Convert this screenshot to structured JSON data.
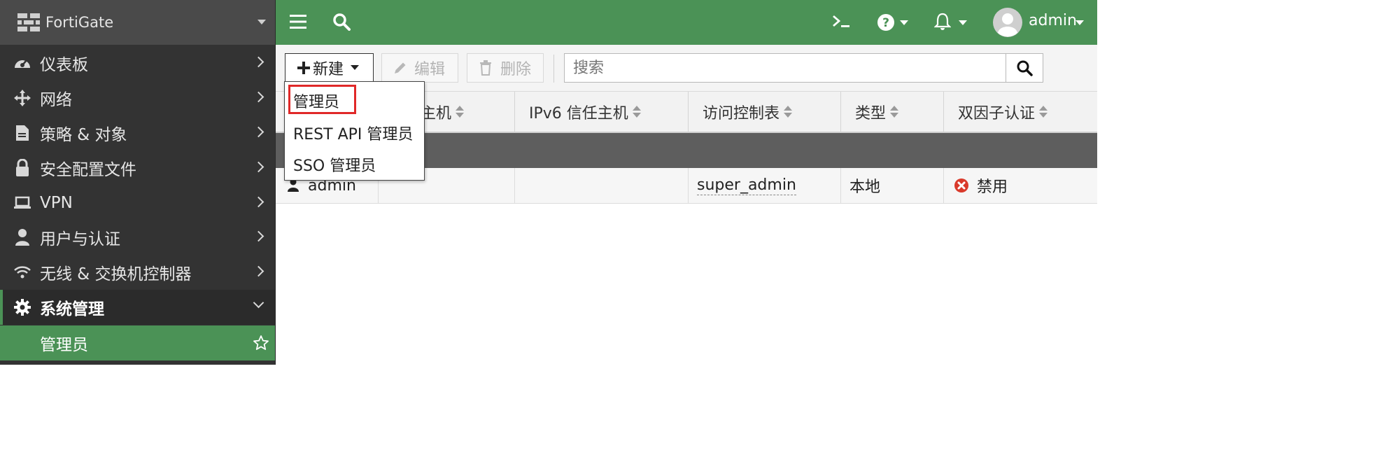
{
  "brand": {
    "name": "FortiGate"
  },
  "sidebar": {
    "items": [
      {
        "label": "仪表板",
        "icon": "dashboard-icon"
      },
      {
        "label": "网络",
        "icon": "move-arrows-icon"
      },
      {
        "label": "策略 & 对象",
        "icon": "policy-icon"
      },
      {
        "label": "安全配置文件",
        "icon": "lock-icon"
      },
      {
        "label": "VPN",
        "icon": "laptop-icon"
      },
      {
        "label": "用户与认证",
        "icon": "user-icon"
      },
      {
        "label": "无线 & 交换机控制器",
        "icon": "wifi-icon"
      },
      {
        "label": "系统管理",
        "icon": "gear-icon"
      }
    ],
    "sub_item": {
      "label": "管理员"
    }
  },
  "topbar": {
    "user": "admin"
  },
  "toolbar": {
    "new_label": "新建",
    "edit_label": "编辑",
    "delete_label": "删除",
    "search_placeholder": "搜索"
  },
  "dropdown": {
    "items": [
      "管理员",
      "REST API 管理员",
      "SSO 管理员"
    ]
  },
  "table": {
    "headers": [
      "主机",
      "IPv6 信任主机",
      "访问控制表",
      "类型",
      "双因子认证"
    ],
    "row": {
      "name": "admin",
      "trusted_hosts": "",
      "ipv6_trusted_hosts": "",
      "access_profile": "super_admin",
      "type": "本地",
      "two_factor": "禁用"
    }
  },
  "colors": {
    "accent": "#4b9256",
    "sidebar": "#333333",
    "highlight": "#e02828"
  }
}
